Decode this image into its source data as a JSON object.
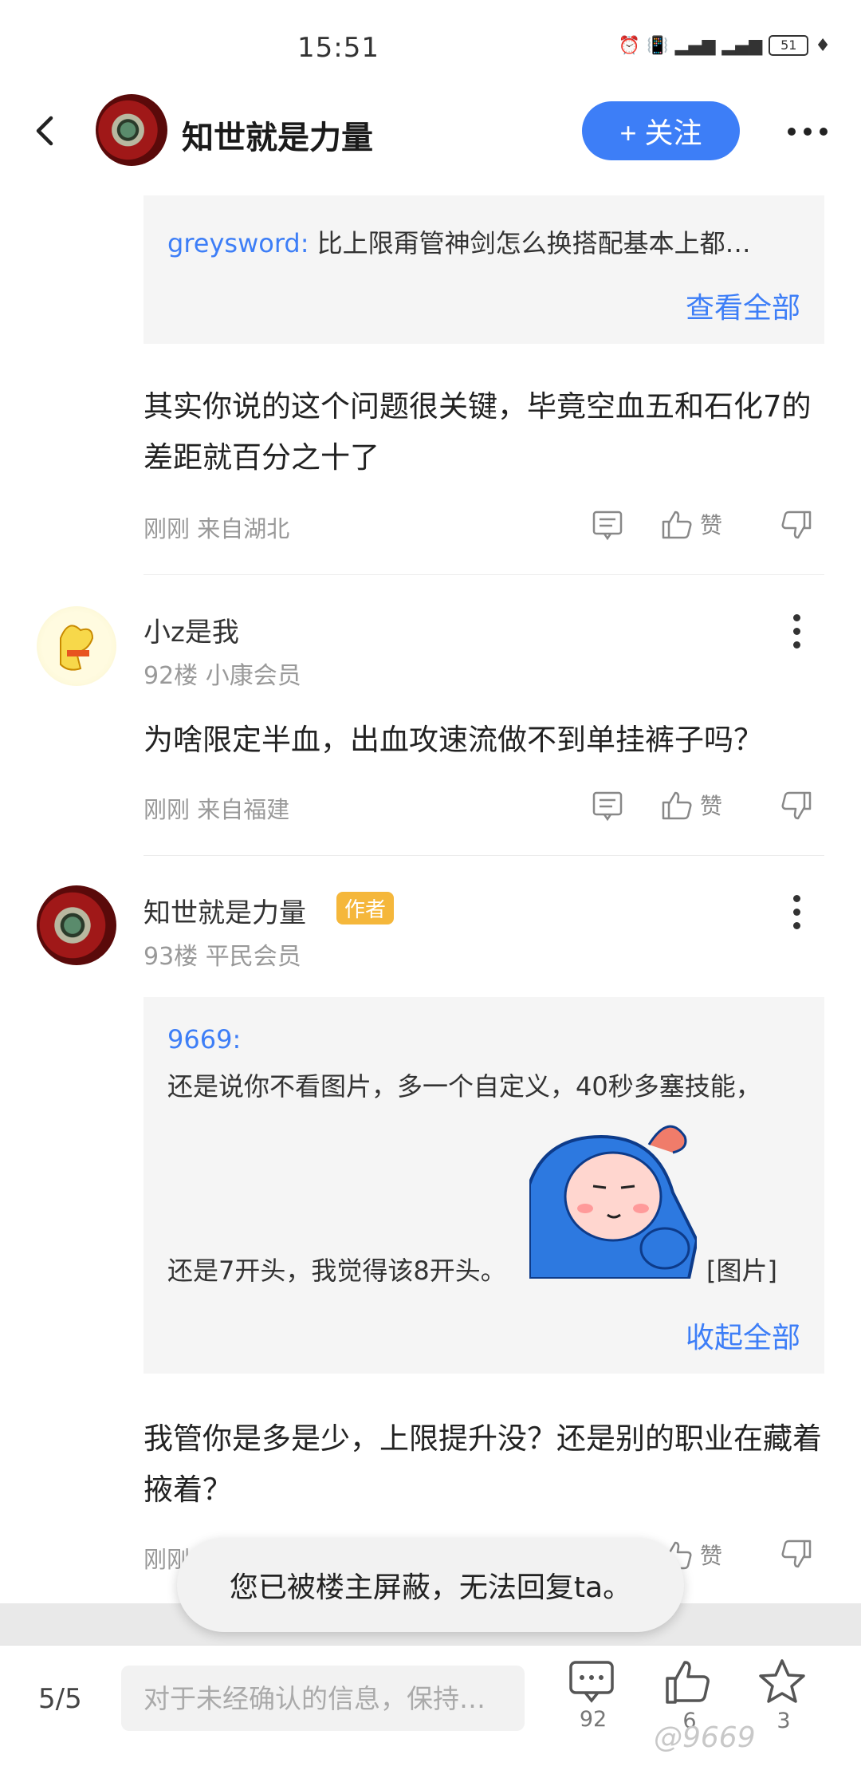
{
  "status": {
    "time": "15:51",
    "battery": "51"
  },
  "header": {
    "title": "知世就是力量",
    "follow_label": "+ 关注"
  },
  "quote1": {
    "user": "greysword:",
    "text": "比上限甭管神剑怎么换搭配基本上都…",
    "expand": "查看全部"
  },
  "post1": {
    "text": "其实你说的这个问题很关键，毕竟空血五和石化7的差距就百分之十了",
    "meta": "刚刚 来自湖北",
    "like_label": "赞"
  },
  "post2": {
    "name": "小z是我",
    "floor": "92楼 小康会员",
    "text": "为啥限定半血，出血攻速流做不到单挂裤子吗？",
    "meta": "刚刚 来自福建",
    "like_label": "赞"
  },
  "post3": {
    "name": "知世就是力量",
    "badge": "作者",
    "floor": "93楼 平民会员",
    "quote": {
      "user": "9669:",
      "line1": "还是说你不看图片，多一个自定义，40秒多塞技能，",
      "line2": "还是7开头，我觉得该8开头。",
      "image_tag": "[图片]",
      "collapse": "收起全部"
    },
    "text": "我管你是多是少，上限提升没？还是别的职业在藏着掖着？",
    "meta": "刚刚",
    "like_label": "赞"
  },
  "toast": "您已被楼主屏蔽，无法回复ta。",
  "bottom": {
    "page": "5/5",
    "input_placeholder": "对于未经确认的信息，保持…",
    "comments": "92",
    "likes": "6",
    "stars": "3"
  },
  "watermark": "@9669",
  "colors": {
    "accent": "#3d7ef7",
    "badge": "#f5b73b"
  }
}
